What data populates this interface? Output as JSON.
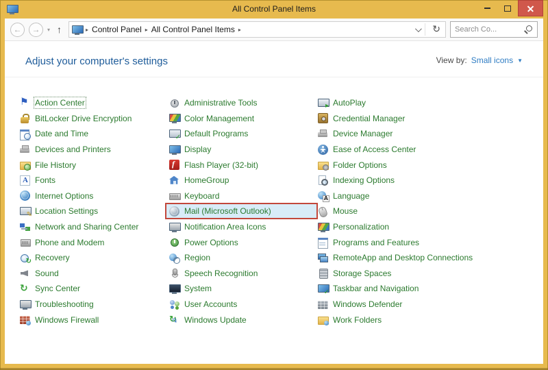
{
  "window": {
    "title": "All Control Panel Items"
  },
  "navbar": {
    "breadcrumb": [
      "Control Panel",
      "All Control Panel Items"
    ],
    "search_placeholder": "Search Co...",
    "icons": [
      "back-icon",
      "forward-icon",
      "dropdown-icon",
      "up-icon",
      "control-panel-icon",
      "address-dropdown-icon",
      "refresh-icon",
      "search-icon"
    ]
  },
  "header": {
    "title": "Adjust your computer's settings",
    "view_by_label": "View by:",
    "view_by_value": "Small icons"
  },
  "glyphs": {
    "back": "←",
    "forward": "→",
    "dropdown_small": "▾",
    "up": "↑",
    "crumb_sep": "▸",
    "refresh": "↻",
    "viewby_caret": "▼"
  },
  "items": [
    {
      "label": "Action Center",
      "icon": "flag-icon"
    },
    {
      "label": "BitLocker Drive Encryption",
      "icon": "lock-icon"
    },
    {
      "label": "Date and Time",
      "icon": "calendar-clock-icon"
    },
    {
      "label": "Devices and Printers",
      "icon": "printer-icon"
    },
    {
      "label": "File History",
      "icon": "folder-history-icon"
    },
    {
      "label": "Fonts",
      "icon": "fonts-icon"
    },
    {
      "label": "Internet Options",
      "icon": "globe-icon"
    },
    {
      "label": "Location Settings",
      "icon": "location-monitor-icon"
    },
    {
      "label": "Network and Sharing Center",
      "icon": "network-icon"
    },
    {
      "label": "Phone and Modem",
      "icon": "phone-modem-icon"
    },
    {
      "label": "Recovery",
      "icon": "recovery-clock-icon"
    },
    {
      "label": "Sound",
      "icon": "speaker-icon"
    },
    {
      "label": "Sync Center",
      "icon": "sync-arrows-icon"
    },
    {
      "label": "Troubleshooting",
      "icon": "troubleshooting-monitor-icon"
    },
    {
      "label": "Windows Firewall",
      "icon": "firewall-brick-icon"
    },
    {
      "label": "Administrative Tools",
      "icon": "admin-tools-icon"
    },
    {
      "label": "Color Management",
      "icon": "color-monitor-icon"
    },
    {
      "label": "Default Programs",
      "icon": "default-programs-icon"
    },
    {
      "label": "Display",
      "icon": "display-monitor-icon"
    },
    {
      "label": "Flash Player (32-bit)",
      "icon": "flash-icon"
    },
    {
      "label": "HomeGroup",
      "icon": "homegroup-house-icon"
    },
    {
      "label": "Keyboard",
      "icon": "keyboard-icon"
    },
    {
      "label": "Mail (Microsoft Outlook)",
      "icon": "mail-icon"
    },
    {
      "label": "Notification Area Icons",
      "icon": "notification-area-icon"
    },
    {
      "label": "Power Options",
      "icon": "power-icon"
    },
    {
      "label": "Region",
      "icon": "region-globe-clock-icon"
    },
    {
      "label": "Speech Recognition",
      "icon": "microphone-icon"
    },
    {
      "label": "System",
      "icon": "system-monitor-icon"
    },
    {
      "label": "User Accounts",
      "icon": "user-accounts-icon"
    },
    {
      "label": "Windows Update",
      "icon": "windows-update-icon"
    },
    {
      "label": "AutoPlay",
      "icon": "autoplay-icon"
    },
    {
      "label": "Credential Manager",
      "icon": "credential-safe-icon"
    },
    {
      "label": "Device Manager",
      "icon": "device-manager-icon"
    },
    {
      "label": "Ease of Access Center",
      "icon": "ease-of-access-icon"
    },
    {
      "label": "Folder Options",
      "icon": "folder-options-icon"
    },
    {
      "label": "Indexing Options",
      "icon": "indexing-search-icon"
    },
    {
      "label": "Language",
      "icon": "language-globe-icon"
    },
    {
      "label": "Mouse",
      "icon": "mouse-icon"
    },
    {
      "label": "Personalization",
      "icon": "personalization-monitor-icon"
    },
    {
      "label": "Programs and Features",
      "icon": "programs-features-icon"
    },
    {
      "label": "RemoteApp and Desktop Connections",
      "icon": "remoteapp-icon"
    },
    {
      "label": "Storage Spaces",
      "icon": "storage-spaces-icon"
    },
    {
      "label": "Taskbar and Navigation",
      "icon": "taskbar-icon"
    },
    {
      "label": "Windows Defender",
      "icon": "defender-wall-icon"
    },
    {
      "label": "Work Folders",
      "icon": "work-folders-icon"
    }
  ],
  "highlight": {
    "item_label": "Mail (Microsoft Outlook)",
    "border_color": "#c2473b",
    "background": "#d8ecf8"
  },
  "colors": {
    "titlebar": "#e7ba4e",
    "close_button": "#d0584b",
    "item_link": "#2b7a2e",
    "heading": "#1e5c9a",
    "view_by_link": "#2e7cc3"
  }
}
